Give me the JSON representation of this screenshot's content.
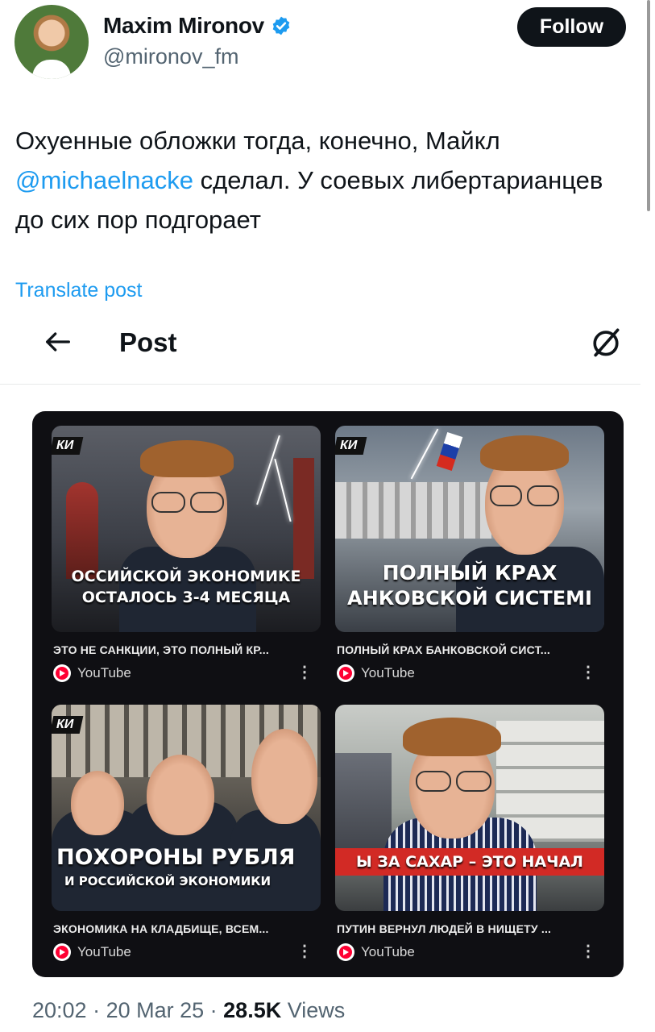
{
  "author": {
    "name": "Maxim Mironov",
    "handle": "@mironov_fm",
    "follow_label": "Follow"
  },
  "tweet": {
    "text_before": "Охуенные обложки тогда, конечно, Майкл",
    "mention": "@michaelnacke",
    "text_after": " сделал. У соевых либертарианцев до сих пор подгорает",
    "translate_label": "Translate post"
  },
  "header": {
    "title": "Post"
  },
  "videos": [
    {
      "corner": "КИ",
      "overlay_line1": "ОССИЙСКОЙ ЭКОНОМИКЕ",
      "overlay_line2": "ОСТАЛОСЬ 3-4 МЕСЯЦА",
      "title": "ЭТО НЕ САНКЦИИ, ЭТО ПОЛНЫЙ КР...",
      "source": "YouTube"
    },
    {
      "corner": "КИ",
      "overlay_line1": "ПОЛНЫЙ КРАХ",
      "overlay_line2": "АНКОВСКОЙ СИСТЕМІ",
      "title": "ПОЛНЫЙ КРАХ БАНКОВСКОЙ СИСТ...",
      "source": "YouTube"
    },
    {
      "corner": "КИ",
      "overlay_line1": "ПОХОРОНЫ РУБЛЯ",
      "overlay_line2": "И РОССИЙСКОЙ ЭКОНОМИКИ",
      "title": "ЭКОНОМИКА НА КЛАДБИЩЕ, ВСЕМ...",
      "source": "YouTube"
    },
    {
      "corner": "",
      "overlay_line1": "Ы ЗА САХАР – ЭТО НАЧАЛ",
      "overlay_line2": "",
      "title": "ПУТИН ВЕРНУЛ ЛЮДЕЙ В НИЩЕТУ ...",
      "source": "YouTube"
    }
  ],
  "meta": {
    "time": "20:02",
    "date": "20 Mar 25",
    "views_count": "28.5K",
    "views_label": "Views"
  },
  "colors": {
    "link": "#1d9bf0",
    "text_primary": "#0f1419",
    "text_secondary": "#536471",
    "media_bg": "#0f0f13"
  }
}
